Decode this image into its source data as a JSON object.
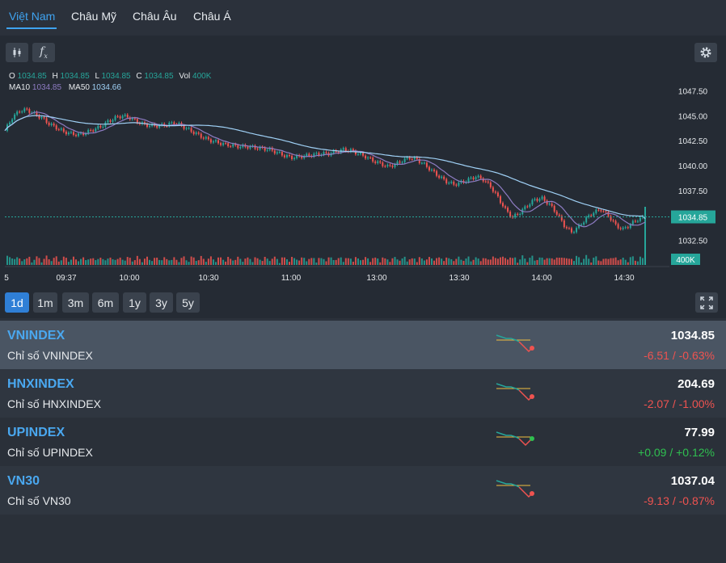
{
  "tabs": [
    "Việt Nam",
    "Châu Mỹ",
    "Châu Âu",
    "Châu Á"
  ],
  "toolbar": {
    "indicator_icon": "candlestick-icon",
    "fx_icon": "function-icon",
    "settings_icon": "gear-icon",
    "fx_label": "f",
    "fx_sub": "x"
  },
  "legend": {
    "o_label": "O",
    "o": "1034.85",
    "h_label": "H",
    "h": "1034.85",
    "l_label": "L",
    "l": "1034.85",
    "c_label": "C",
    "c": "1034.85",
    "vol_label": "Vol",
    "vol": "400K",
    "ma10_label": "MA10",
    "ma10": "1034.85",
    "ma50_label": "MA50",
    "ma50": "1034.66"
  },
  "chart_data": {
    "type": "line",
    "y_ticks": [
      "1047.50",
      "1045.00",
      "1042.50",
      "1040.00",
      "1037.50",
      "1032.50"
    ],
    "y_range": [
      1031.0,
      1049.0
    ],
    "x_ticks": [
      "5",
      "09:37",
      "10:00",
      "10:30",
      "11:00",
      "13:00",
      "13:30",
      "14:00",
      "14:30"
    ],
    "current_price_label": "1034.85",
    "current_price": 1034.85,
    "volume_label": "400K",
    "price_series": [
      1043.5,
      1044.8,
      1045.5,
      1045.6,
      1045.2,
      1044.8,
      1044.2,
      1043.8,
      1043.4,
      1043.2,
      1043.1,
      1043.3,
      1043.6,
      1043.9,
      1044.4,
      1044.8,
      1045.0,
      1044.8,
      1044.4,
      1044.1,
      1044.0,
      1044.0,
      1044.1,
      1044.3,
      1044.0,
      1043.6,
      1043.2,
      1042.8,
      1042.5,
      1042.3,
      1042.1,
      1042.0,
      1041.9,
      1041.9,
      1041.8,
      1041.7,
      1041.6,
      1041.3,
      1041.0,
      1040.8,
      1040.9,
      1041.0,
      1041.1,
      1041.2,
      1041.2,
      1041.4,
      1041.6,
      1041.5,
      1041.2,
      1040.9,
      1040.5,
      1040.2,
      1039.9,
      1040.1,
      1040.5,
      1040.8,
      1040.6,
      1040.1,
      1039.5,
      1038.9,
      1038.4,
      1038.1,
      1038.3,
      1038.6,
      1038.9,
      1038.6,
      1037.9,
      1036.8,
      1035.6,
      1034.8,
      1035.3,
      1036.0,
      1036.6,
      1036.7,
      1036.1,
      1035.2,
      1034.0,
      1033.3,
      1033.9,
      1034.7,
      1035.3,
      1035.6,
      1035.0,
      1034.0,
      1033.6,
      1034.1,
      1034.6,
      1034.85
    ]
  },
  "ranges": [
    "1d",
    "1m",
    "3m",
    "6m",
    "1y",
    "3y",
    "5y"
  ],
  "expand_icon": "expand-icon",
  "indices": [
    {
      "symbol": "VNINDEX",
      "name": "Chỉ số VNINDEX",
      "price": "1034.85",
      "change": "-6.51 / -0.63%",
      "direction": "down"
    },
    {
      "symbol": "HNXINDEX",
      "name": "Chỉ số HNXINDEX",
      "price": "204.69",
      "change": "-2.07 / -1.00%",
      "direction": "down"
    },
    {
      "symbol": "UPINDEX",
      "name": "Chỉ số UPINDEX",
      "price": "77.99",
      "change": "+0.09 / +0.12%",
      "direction": "up"
    },
    {
      "symbol": "VN30",
      "name": "Chỉ số VN30",
      "price": "1037.04",
      "change": "-9.13 / -0.87%",
      "direction": "down"
    }
  ],
  "colors": {
    "accent": "#3fa3f0",
    "up": "#2fbf50",
    "down": "#ef5350",
    "candle_up": "#26a69a",
    "candle_down": "#ef5350",
    "ma10": "#8e7cc3",
    "ma50": "#9fd0f5"
  }
}
